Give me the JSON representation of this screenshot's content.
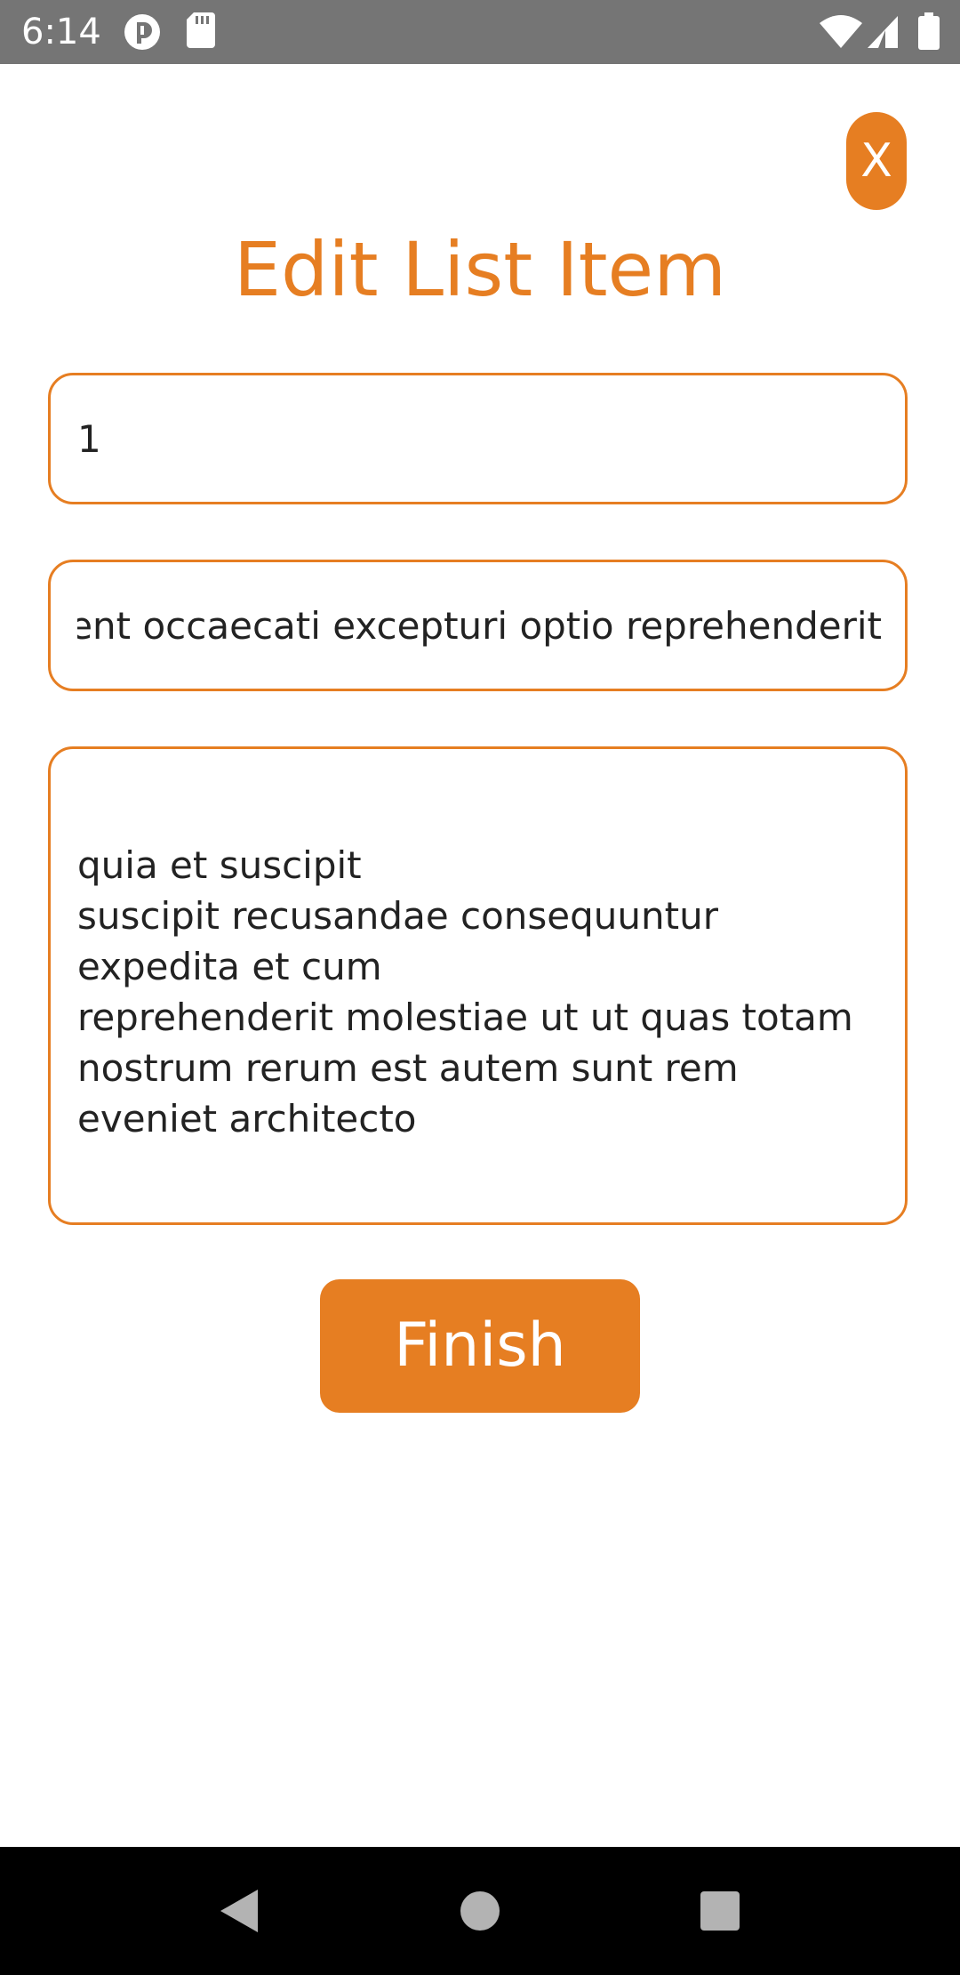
{
  "status_bar": {
    "time": "6:14",
    "left_icons": [
      "app-notification-icon",
      "sd-card-icon"
    ],
    "right_icons": [
      "wifi-icon",
      "cell-signal-icon",
      "battery-icon"
    ],
    "background": "#757575"
  },
  "dialog": {
    "close_label": "X",
    "title": "Edit List Item",
    "accent_color": "#E67E22",
    "id_field_value": "1",
    "title_field_value": "sunt aut facere repellat provident occaecati excepturi optio reprehenderit",
    "title_field_visible": "ent occaecati excepturi optio reprehenderit",
    "body_field_value": "quia et suscipit\nsuscipit recusandae consequuntur expedita et cum\nreprehenderit molestiae ut ut quas totam\nnostrum rerum est autem sunt rem eveniet architecto",
    "finish_label": "Finish"
  },
  "nav_bar": {
    "icons": [
      "back-icon",
      "home-icon",
      "recents-icon"
    ]
  }
}
